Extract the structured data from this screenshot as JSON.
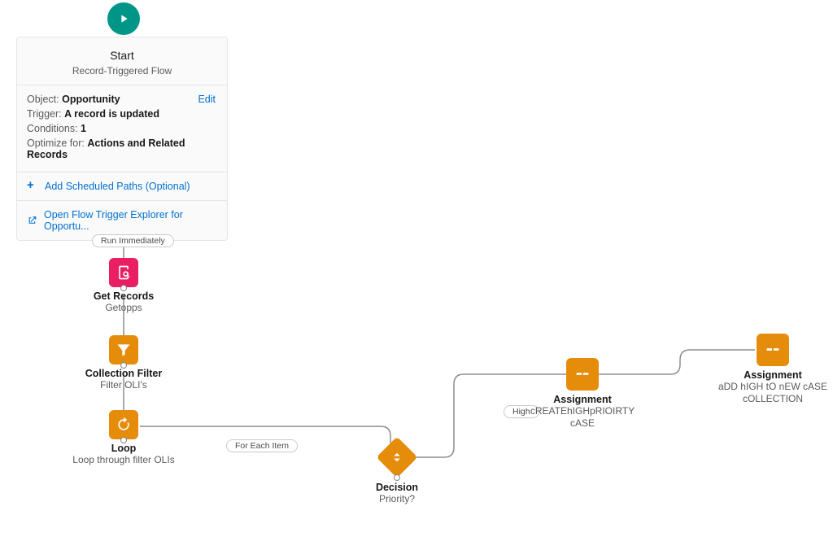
{
  "start": {
    "title": "Start",
    "subtitle": "Record-Triggered Flow",
    "object_label": "Object:",
    "object_value": "Opportunity",
    "trigger_label": "Trigger:",
    "trigger_value": "A record is updated",
    "conditions_label": "Conditions:",
    "conditions_value": "1",
    "optimize_label": "Optimize for:",
    "optimize_value": "Actions and Related Records",
    "edit": "Edit",
    "add_paths": "Add Scheduled Paths (Optional)",
    "open_explorer": "Open Flow Trigger Explorer for Opportu..."
  },
  "labels": {
    "run_immediately": "Run Immediately",
    "for_each_item": "For Each Item",
    "high": "High"
  },
  "nodes": {
    "get_records": {
      "title": "Get Records",
      "sub": "Getopps"
    },
    "collection_filter": {
      "title": "Collection Filter",
      "sub": "Filter OLI's"
    },
    "loop": {
      "title": "Loop",
      "sub": "Loop through filter OLIs"
    },
    "decision": {
      "title": "Decision",
      "sub": "Priority?"
    },
    "assignment1": {
      "title": "Assignment",
      "sub": "cREATEhIGHpRIOIRTY cASE"
    },
    "assignment2": {
      "title": "Assignment",
      "sub": "aDD hIGH tO nEW cASE cOLLECTION"
    }
  }
}
